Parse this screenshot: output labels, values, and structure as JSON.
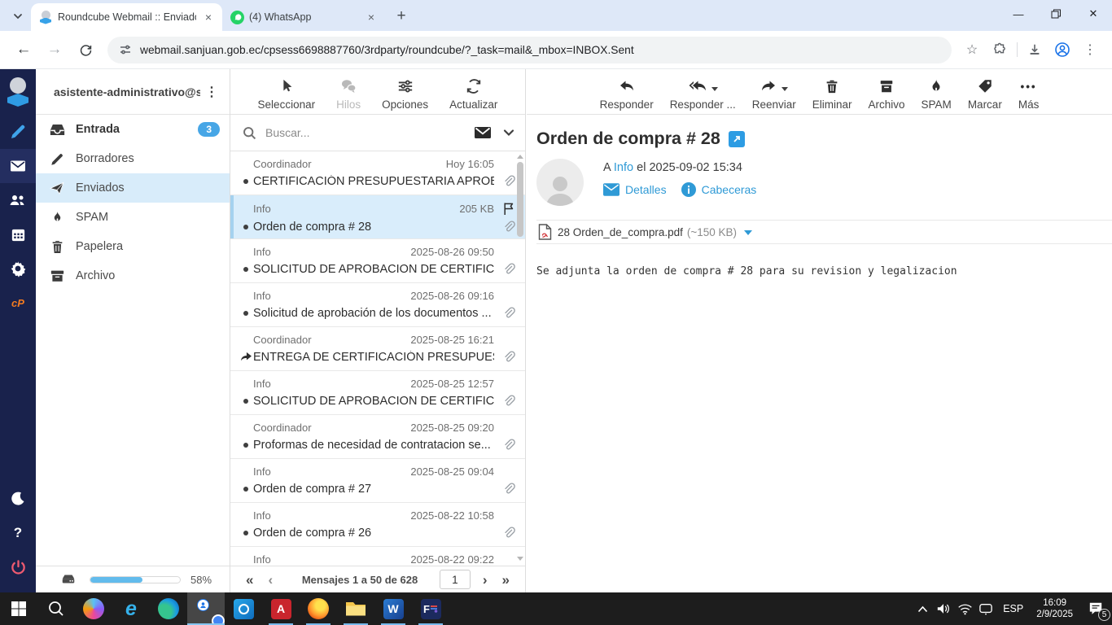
{
  "browser": {
    "tab1": {
      "title": "Roundcube Webmail :: Enviados"
    },
    "tab2": {
      "title": "(4) WhatsApp"
    },
    "url": "webmail.sanjuan.gob.ec/cpsess6698887760/3rdparty/roundcube/?_task=mail&_mbox=INBOX.Sent"
  },
  "rail": {
    "cpanel_label": "cP",
    "help_label": "?"
  },
  "mailbox": {
    "account": "asistente-administrativo@sa...",
    "folders": [
      {
        "label": "Entrada",
        "icon": "inbox",
        "badge": "3",
        "bold": true
      },
      {
        "label": "Borradores",
        "icon": "pencil"
      },
      {
        "label": "Enviados",
        "icon": "send",
        "selected": true
      },
      {
        "label": "SPAM",
        "icon": "fire"
      },
      {
        "label": "Papelera",
        "icon": "trash"
      },
      {
        "label": "Archivo",
        "icon": "archive"
      }
    ]
  },
  "list_toolbar": {
    "select": "Seleccionar",
    "threads": "Hilos",
    "options": "Opciones",
    "refresh": "Actualizar"
  },
  "search": {
    "placeholder": "Buscar..."
  },
  "messages": [
    {
      "sender": "Coordinador",
      "meta": "Hoy 16:05",
      "subject": "CERTIFICACIÓN PRESUPUESTARIA APROB...",
      "unread_dot": true,
      "attachment": true
    },
    {
      "sender": "Info",
      "meta": "205 KB",
      "subject": "Orden de compra # 28",
      "unread_dot": true,
      "attachment": true,
      "selected": true,
      "flag": true
    },
    {
      "sender": "Info",
      "meta": "2025-08-26 09:50",
      "subject": "SOLICITUD DE APROBACION DE CERTIFICA...",
      "unread_dot": true,
      "attachment": true
    },
    {
      "sender": "Info",
      "meta": "2025-08-26 09:16",
      "subject": "Solicitud de aprobación de los documentos ...",
      "unread_dot": true,
      "attachment": true
    },
    {
      "sender": "Coordinador",
      "meta": "2025-08-25 16:21",
      "subject": "ENTREGA DE CERTIFICACIÓN PRESUPUEST...",
      "forwarded": true,
      "attachment": true
    },
    {
      "sender": "Info",
      "meta": "2025-08-25 12:57",
      "subject": "SOLICITUD DE APROBACION DE CERTIFICA...",
      "unread_dot": true,
      "attachment": true
    },
    {
      "sender": "Coordinador",
      "meta": "2025-08-25 09:20",
      "subject": "Proformas de necesidad de contratacion se...",
      "unread_dot": true,
      "attachment": true
    },
    {
      "sender": "Info",
      "meta": "2025-08-25 09:04",
      "subject": "Orden de compra # 27",
      "unread_dot": true,
      "attachment": true
    },
    {
      "sender": "Info",
      "meta": "2025-08-22 10:58",
      "subject": "Orden de compra # 26",
      "unread_dot": true,
      "attachment": true
    },
    {
      "sender": "Info",
      "meta": "2025-08-22 09:22",
      "subject": "",
      "attachment": false
    }
  ],
  "footer": {
    "quota_percent": "58%",
    "range": "Mensajes 1 a 50 de 628",
    "page": "1"
  },
  "msg_toolbar": {
    "reply": "Responder",
    "reply_all": "Responder ...",
    "forward": "Reenviar",
    "delete": "Eliminar",
    "archive": "Archivo",
    "spam": "SPAM",
    "mark": "Marcar",
    "more": "Más"
  },
  "message": {
    "subject": "Orden de compra # 28",
    "to_prefix": "A",
    "to": "Info",
    "date_text": "el 2025-09-02 15:34",
    "details": "Detalles",
    "headers": "Cabeceras",
    "attachment": {
      "name": "28 Orden_de_compra.pdf",
      "size": "(~150 KB)"
    },
    "body": "Se adjunta la orden de compra # 28 para su revision y legalizacion"
  },
  "tray": {
    "lang": "ESP",
    "time": "16:09",
    "date": "2/9/2025",
    "notif_count": "5"
  }
}
